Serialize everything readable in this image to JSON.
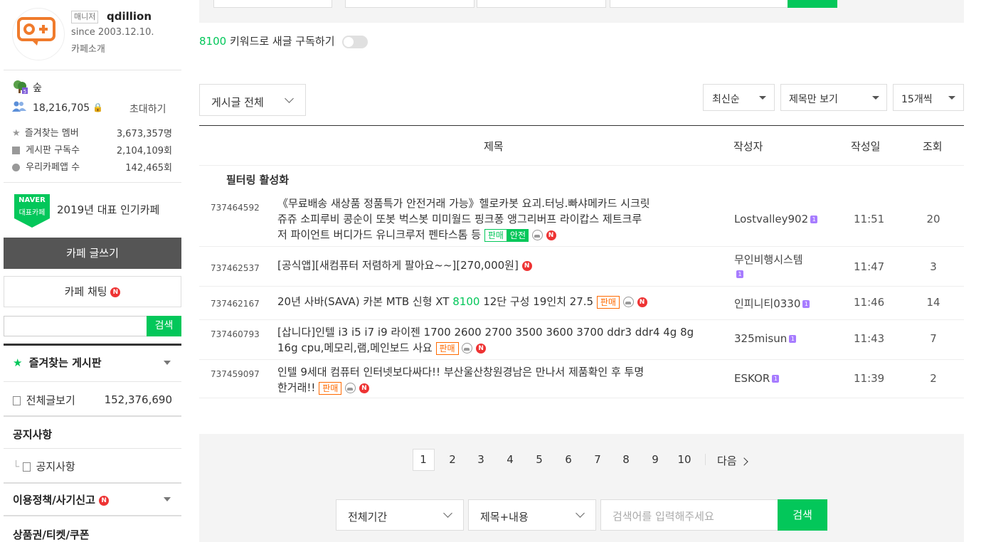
{
  "cafe": {
    "manager_badge": "매니저",
    "name": "qdillion",
    "since": "since 2003.12.10.",
    "intro_link": "카페소개",
    "level_name": "숲",
    "members": "18,216,705",
    "invite": "초대하기",
    "stats": [
      {
        "label": "즐겨찾는 멤버",
        "value": "3,673,357명",
        "icon": "star-icon"
      },
      {
        "label": "게시판 구독수",
        "value": "2,104,109회",
        "icon": "rss-icon"
      },
      {
        "label": "우리카페앱 수",
        "value": "142,465회",
        "icon": "app-icon"
      }
    ],
    "naver_badge_top": "NAVER",
    "naver_badge_bottom": "대표카페",
    "award_text": "2019년 대표 인기카페"
  },
  "sidebar": {
    "write_button": "카페 글쓰기",
    "chat_button": "카페 채팅",
    "new_mark": "N",
    "search_button": "검색",
    "favorites_title": "즐겨찾는 게시판",
    "all_posts_label": "전체글보기",
    "all_posts_count": "152,376,690",
    "notice_section": "공지사항",
    "notice_item": "공지사항",
    "policy_section": "이용정책/사기신고",
    "voucher_section": "상품권/티켓/쿠폰"
  },
  "keyword": {
    "term": "8100",
    "text": "키워드로 새글 구독하기"
  },
  "filters": {
    "board_select": "게시글 전체",
    "sort_select": "최신순",
    "view_select": "제목만 보기",
    "count_select": "15개씩"
  },
  "table": {
    "headers": {
      "title": "제목",
      "writer": "작성자",
      "date": "작성일",
      "views": "조회"
    },
    "filter_label": "필터링 활성화",
    "rows": [
      {
        "no": "737464592",
        "title_lines": [
          "《무료배송 새상품 정품특가 안전거래 가능》헬로카봇 요괴.터닝.빠샤메카드 시크릿",
          "쥬쥬 소피루비 콩순이 또봇 벅스봇 미미월드 핑크퐁 앵그리버프 라이캅스 제트크루",
          "저 파이언트 버디가드 유니크루저 펜타스톰 등"
        ],
        "sell_tag": "판매",
        "safe_tag": "안전",
        "writer": "Lostvalley902",
        "date": "11:51",
        "views": "20"
      },
      {
        "no": "737462537",
        "title_lines": [
          "[공식앱][새컴퓨터 저렴하게 팔아요~~][270,000원]"
        ],
        "sell_tag": "",
        "safe_tag": "",
        "writer": "무인비행시스템",
        "date": "11:47",
        "views": "3"
      },
      {
        "no": "737462167",
        "title_pre": "20년 사바(SAVA) 카본 MTB 신형 XT ",
        "title_highlight": "8100",
        "title_post": " 12단 구성 19인치 27.5",
        "sell_tag": "판매",
        "writer": "인피니티0330",
        "date": "11:46",
        "views": "14"
      },
      {
        "no": "737460793",
        "title_lines": [
          "[삽니다]인텔 i3 i5 i7 i9 라이젠 1700 2600 2700 3500 3600 3700 ddr3 ddr4 4g 8g",
          "16g cpu,메모리,램,메인보드 사요"
        ],
        "sell_tag": "판매",
        "writer": "325misun",
        "date": "11:43",
        "views": "7"
      },
      {
        "no": "737459097",
        "title_lines": [
          "인텔 9세대 컴퓨터 인터넷보다싸다!! 부산울산창원경남은 만나서 제품확인 후 투명",
          "한거래!!"
        ],
        "sell_tag": "판매",
        "writer": "ESKOR",
        "date": "11:39",
        "views": "2"
      }
    ]
  },
  "pager": {
    "pages": [
      "1",
      "2",
      "3",
      "4",
      "5",
      "6",
      "7",
      "8",
      "9",
      "10"
    ],
    "current": "1",
    "next": "다음"
  },
  "bottom_search": {
    "period": "전체기간",
    "scope": "제목+내용",
    "placeholder": "검색어를 입력해주세요",
    "button": "검색"
  },
  "colors": {
    "accent": "#03c75a",
    "sell": "#ff6a00",
    "new": "#e33333",
    "level": "#a77cff"
  }
}
